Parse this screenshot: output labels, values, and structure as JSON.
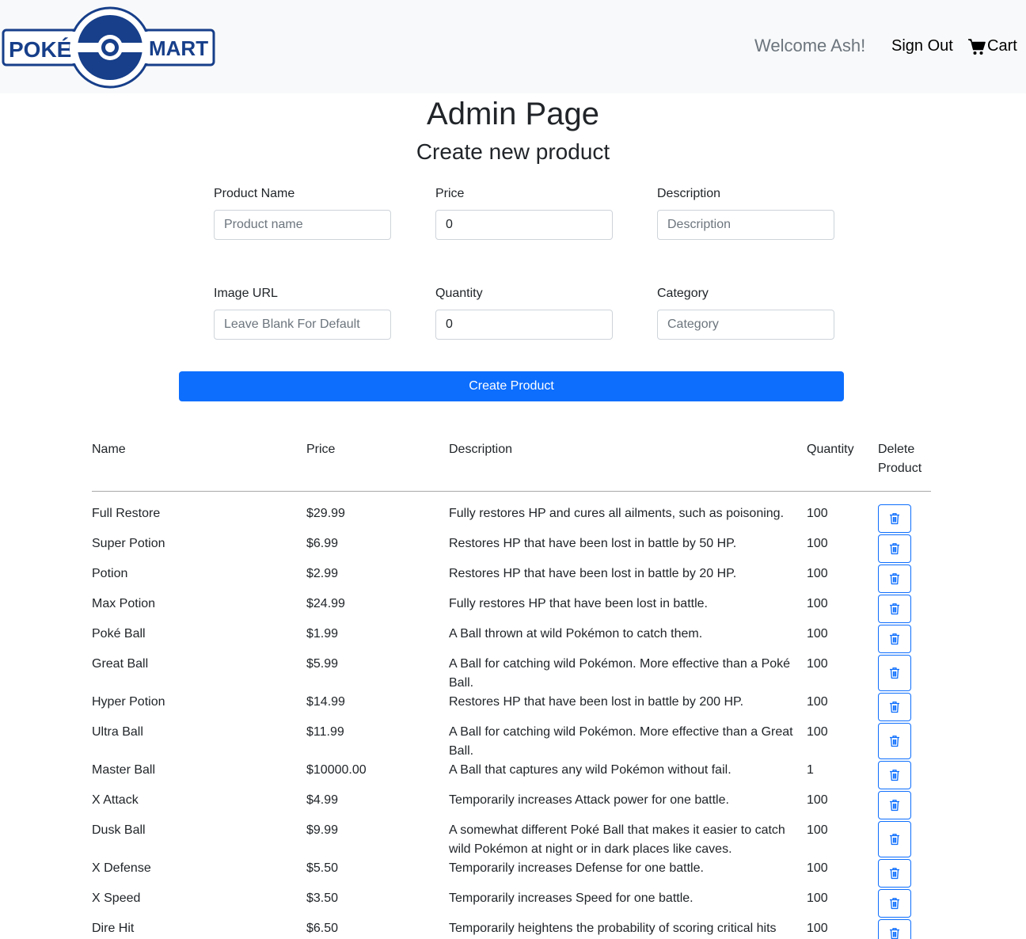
{
  "brand": {
    "left": "POKÉ",
    "right": "MART",
    "color": "#173f8a"
  },
  "nav": {
    "welcome": "Welcome Ash!",
    "sign_out": "Sign Out",
    "cart": "Cart"
  },
  "page": {
    "title": "Admin Page",
    "subtitle": "Create new product"
  },
  "form": {
    "product_name": {
      "label": "Product Name",
      "placeholder": "Product name",
      "value": ""
    },
    "price": {
      "label": "Price",
      "value": "0"
    },
    "description": {
      "label": "Description",
      "placeholder": "Description",
      "value": ""
    },
    "image_url": {
      "label": "Image URL",
      "placeholder": "Leave Blank For Default",
      "value": ""
    },
    "quantity": {
      "label": "Quantity",
      "value": "0"
    },
    "category": {
      "label": "Category",
      "placeholder": "Category",
      "value": ""
    },
    "submit_label": "Create Product"
  },
  "table": {
    "headers": {
      "name": "Name",
      "price": "Price",
      "description": "Description",
      "quantity": "Quantity",
      "delete_line1": "Delete",
      "delete_line2": "Product"
    },
    "rows": [
      {
        "name": "Full Restore",
        "price": "$29.99",
        "description": "Fully restores HP and cures all ailments, such as poisoning.",
        "quantity": "100"
      },
      {
        "name": "Super Potion",
        "price": "$6.99",
        "description": "Restores HP that have been lost in battle by 50 HP.",
        "quantity": "100"
      },
      {
        "name": "Potion",
        "price": "$2.99",
        "description": "Restores HP that have been lost in battle by 20 HP.",
        "quantity": "100"
      },
      {
        "name": "Max Potion",
        "price": "$24.99",
        "description": "Fully restores HP that have been lost in battle.",
        "quantity": "100"
      },
      {
        "name": "Poké Ball",
        "price": "$1.99",
        "description": "A Ball thrown at wild Pokémon to catch them.",
        "quantity": "100"
      },
      {
        "name": "Great Ball",
        "price": "$5.99",
        "description": "A Ball for catching wild Pokémon. More effective than a Poké Ball.",
        "quantity": "100"
      },
      {
        "name": "Hyper Potion",
        "price": "$14.99",
        "description": "Restores HP that have been lost in battle by 200 HP.",
        "quantity": "100"
      },
      {
        "name": "Ultra Ball",
        "price": "$11.99",
        "description": "A Ball for catching wild Pokémon. More effective than a Great Ball.",
        "quantity": "100"
      },
      {
        "name": "Master Ball",
        "price": "$10000.00",
        "description": "A Ball that captures any wild Pokémon without fail.",
        "quantity": "1"
      },
      {
        "name": "X Attack",
        "price": "$4.99",
        "description": "Temporarily increases Attack power for one battle.",
        "quantity": "100"
      },
      {
        "name": "Dusk Ball",
        "price": "$9.99",
        "description": "A somewhat different Poké Ball that makes it easier to catch wild Pokémon at night or in dark places like caves.",
        "quantity": "100"
      },
      {
        "name": "X Defense",
        "price": "$5.50",
        "description": "Temporarily increases Defense for one battle.",
        "quantity": "100"
      },
      {
        "name": "X Speed",
        "price": "$3.50",
        "description": "Temporarily increases Speed for one battle.",
        "quantity": "100"
      },
      {
        "name": "Dire Hit",
        "price": "$6.50",
        "description": "Temporarily heightens the probability of scoring critical hits",
        "quantity": "100"
      }
    ]
  },
  "colors": {
    "primary": "#0d6efd",
    "navbar_bg": "#f8f9fa",
    "muted": "#6c757d"
  },
  "icons": {
    "cart": "cart-icon",
    "delete": "trash-icon",
    "logo": "pokeball-logo"
  }
}
